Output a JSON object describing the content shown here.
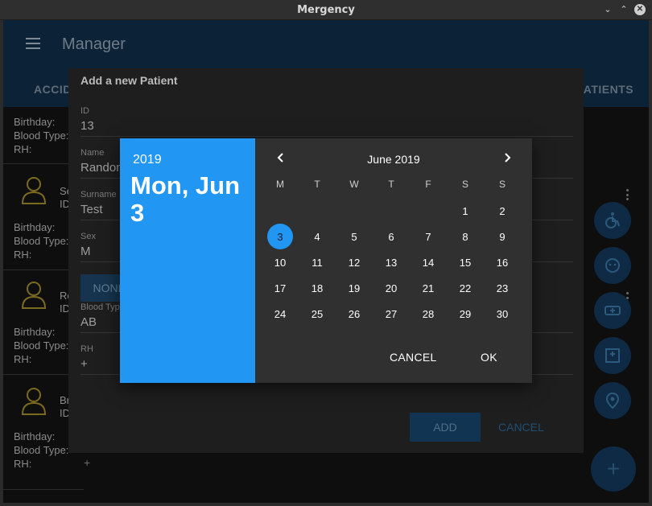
{
  "window": {
    "title": "Mergency"
  },
  "appbar": {
    "title": "Manager",
    "tab_left": "ACCIDENTS",
    "tab_right": "PATIENTS"
  },
  "list": {
    "labels": {
      "birthday": "Birthday:",
      "blood_type": "Blood Type:",
      "rh": "RH:"
    },
    "name_frags": [
      "Se",
      "ID",
      "Ro",
      "ID",
      "Br",
      "ID"
    ]
  },
  "patient_dialog": {
    "title": "Add a new Patient",
    "fields": {
      "id": {
        "label": "ID",
        "value": "13"
      },
      "name": {
        "label": "Name",
        "value": "Random"
      },
      "surname": {
        "label": "Surname",
        "value": "Test"
      },
      "sex": {
        "label": "Sex",
        "value": "M"
      },
      "blood_type": {
        "label": "Blood Type",
        "value": "AB"
      },
      "rh": {
        "label": "RH",
        "value": "+"
      }
    },
    "none_button": "NONE",
    "add_button": "ADD",
    "cancel_button": "CANCEL",
    "plus": "+"
  },
  "date_picker": {
    "year": "2019",
    "selected_date": "Mon, Jun 3",
    "month_label": "June 2019",
    "weekday_headers": [
      "M",
      "T",
      "W",
      "T",
      "F",
      "S",
      "S"
    ],
    "weeks": [
      [
        "",
        "",
        "",
        "",
        "",
        "1",
        "2"
      ],
      [
        "3",
        "4",
        "5",
        "6",
        "7",
        "8",
        "9"
      ],
      [
        "10",
        "11",
        "12",
        "13",
        "14",
        "15",
        "16"
      ],
      [
        "17",
        "18",
        "19",
        "20",
        "21",
        "22",
        "23"
      ],
      [
        "24",
        "25",
        "26",
        "27",
        "28",
        "29",
        "30"
      ]
    ],
    "selected_day": "3",
    "cancel_label": "CANCEL",
    "ok_label": "OK"
  },
  "fab": {
    "label": "+"
  },
  "colors": {
    "accent": "#2196f3",
    "picker_bg": "#303030"
  }
}
